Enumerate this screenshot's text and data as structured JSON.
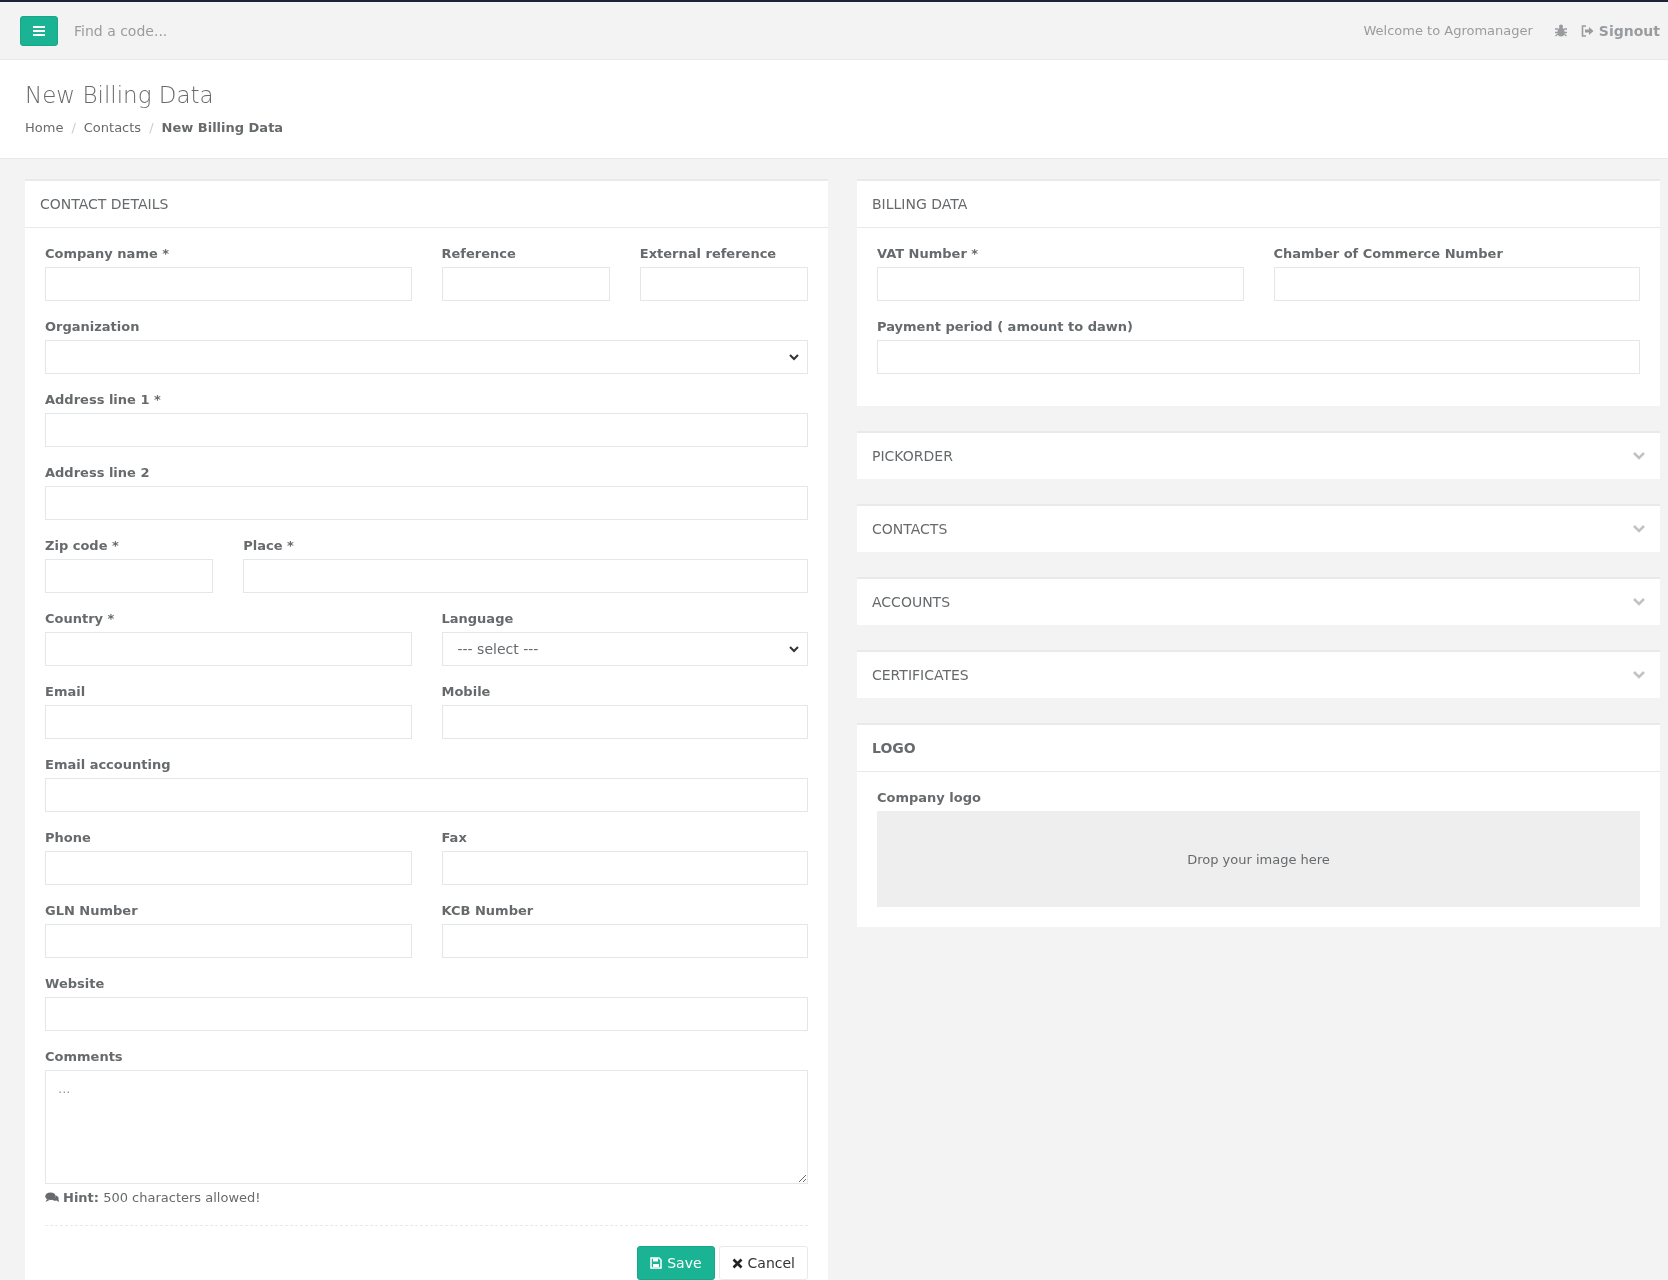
{
  "topbar": {
    "search": {
      "placeholder": "Find a code..."
    },
    "welcome": "Welcome to Agromanager",
    "signout": "Signout"
  },
  "header": {
    "title": "New Billing Data",
    "breadcrumb": [
      {
        "label": "Home",
        "selected": false
      },
      {
        "separator": "/",
        "label": "Contacts",
        "selected": false
      },
      {
        "separator": "/",
        "label": "New Billing Data",
        "selected": true
      }
    ]
  },
  "contact_details": {
    "title": "CONTACT DETAILS",
    "rows": [
      [
        {
          "kind": "text",
          "label": "Company name *"
        },
        {
          "kind": "text",
          "label": "Reference"
        },
        {
          "kind": "text",
          "label": "External reference"
        }
      ],
      [
        {
          "kind": "select",
          "label": "Organization"
        }
      ],
      [
        {
          "kind": "text",
          "label": "Address line 1 *"
        }
      ],
      [
        {
          "kind": "text",
          "label": "Address line 2"
        }
      ],
      [
        {
          "kind": "text",
          "label": "Zip code *"
        },
        {
          "kind": "text",
          "label": "Place *"
        }
      ],
      [
        {
          "kind": "text",
          "label": "Country *"
        },
        {
          "kind": "select",
          "label": "Language",
          "value": "--- select ---"
        }
      ],
      [
        {
          "kind": "text",
          "label": "Email"
        },
        {
          "kind": "text",
          "label": "Mobile"
        }
      ],
      [
        {
          "kind": "text",
          "label": "Email accounting"
        }
      ],
      [
        {
          "kind": "text",
          "label": "Phone"
        },
        {
          "kind": "text",
          "label": "Fax"
        }
      ],
      [
        {
          "kind": "text",
          "label": "GLN Number"
        },
        {
          "kind": "text",
          "label": "KCB Number"
        }
      ],
      [
        {
          "kind": "text",
          "label": "Website"
        }
      ],
      [
        {
          "kind": "textarea",
          "label": "Comments",
          "placeholder": "..."
        }
      ]
    ],
    "hint": "**Hint:** 500 characters allowed!",
    "buttons": [
      {
        "kind": "primary",
        "label": "Save"
      },
      {
        "kind": "default",
        "label": "Cancel"
      }
    ]
  },
  "billing_data": {
    "title": "BILLING DATA",
    "rows": [
      [
        {
          "kind": "text",
          "label": "VAT Number *"
        },
        {
          "kind": "text",
          "label": "Chamber of Commerce Number"
        }
      ],
      [
        {
          "kind": "text",
          "label": "Payment period ( amount to dawn)"
        }
      ]
    ]
  },
  "collapsed_panels": [
    {
      "title": "PICKORDER",
      "expanded": false
    },
    {
      "title": "CONTACTS",
      "expanded": false
    },
    {
      "title": "ACCOUNTS",
      "expanded": false
    },
    {
      "title": "CERTIFICATES",
      "expanded": false
    }
  ],
  "logo": {
    "title": "LOGO",
    "label": "Company logo",
    "dropzone": "Drop your image here"
  }
}
